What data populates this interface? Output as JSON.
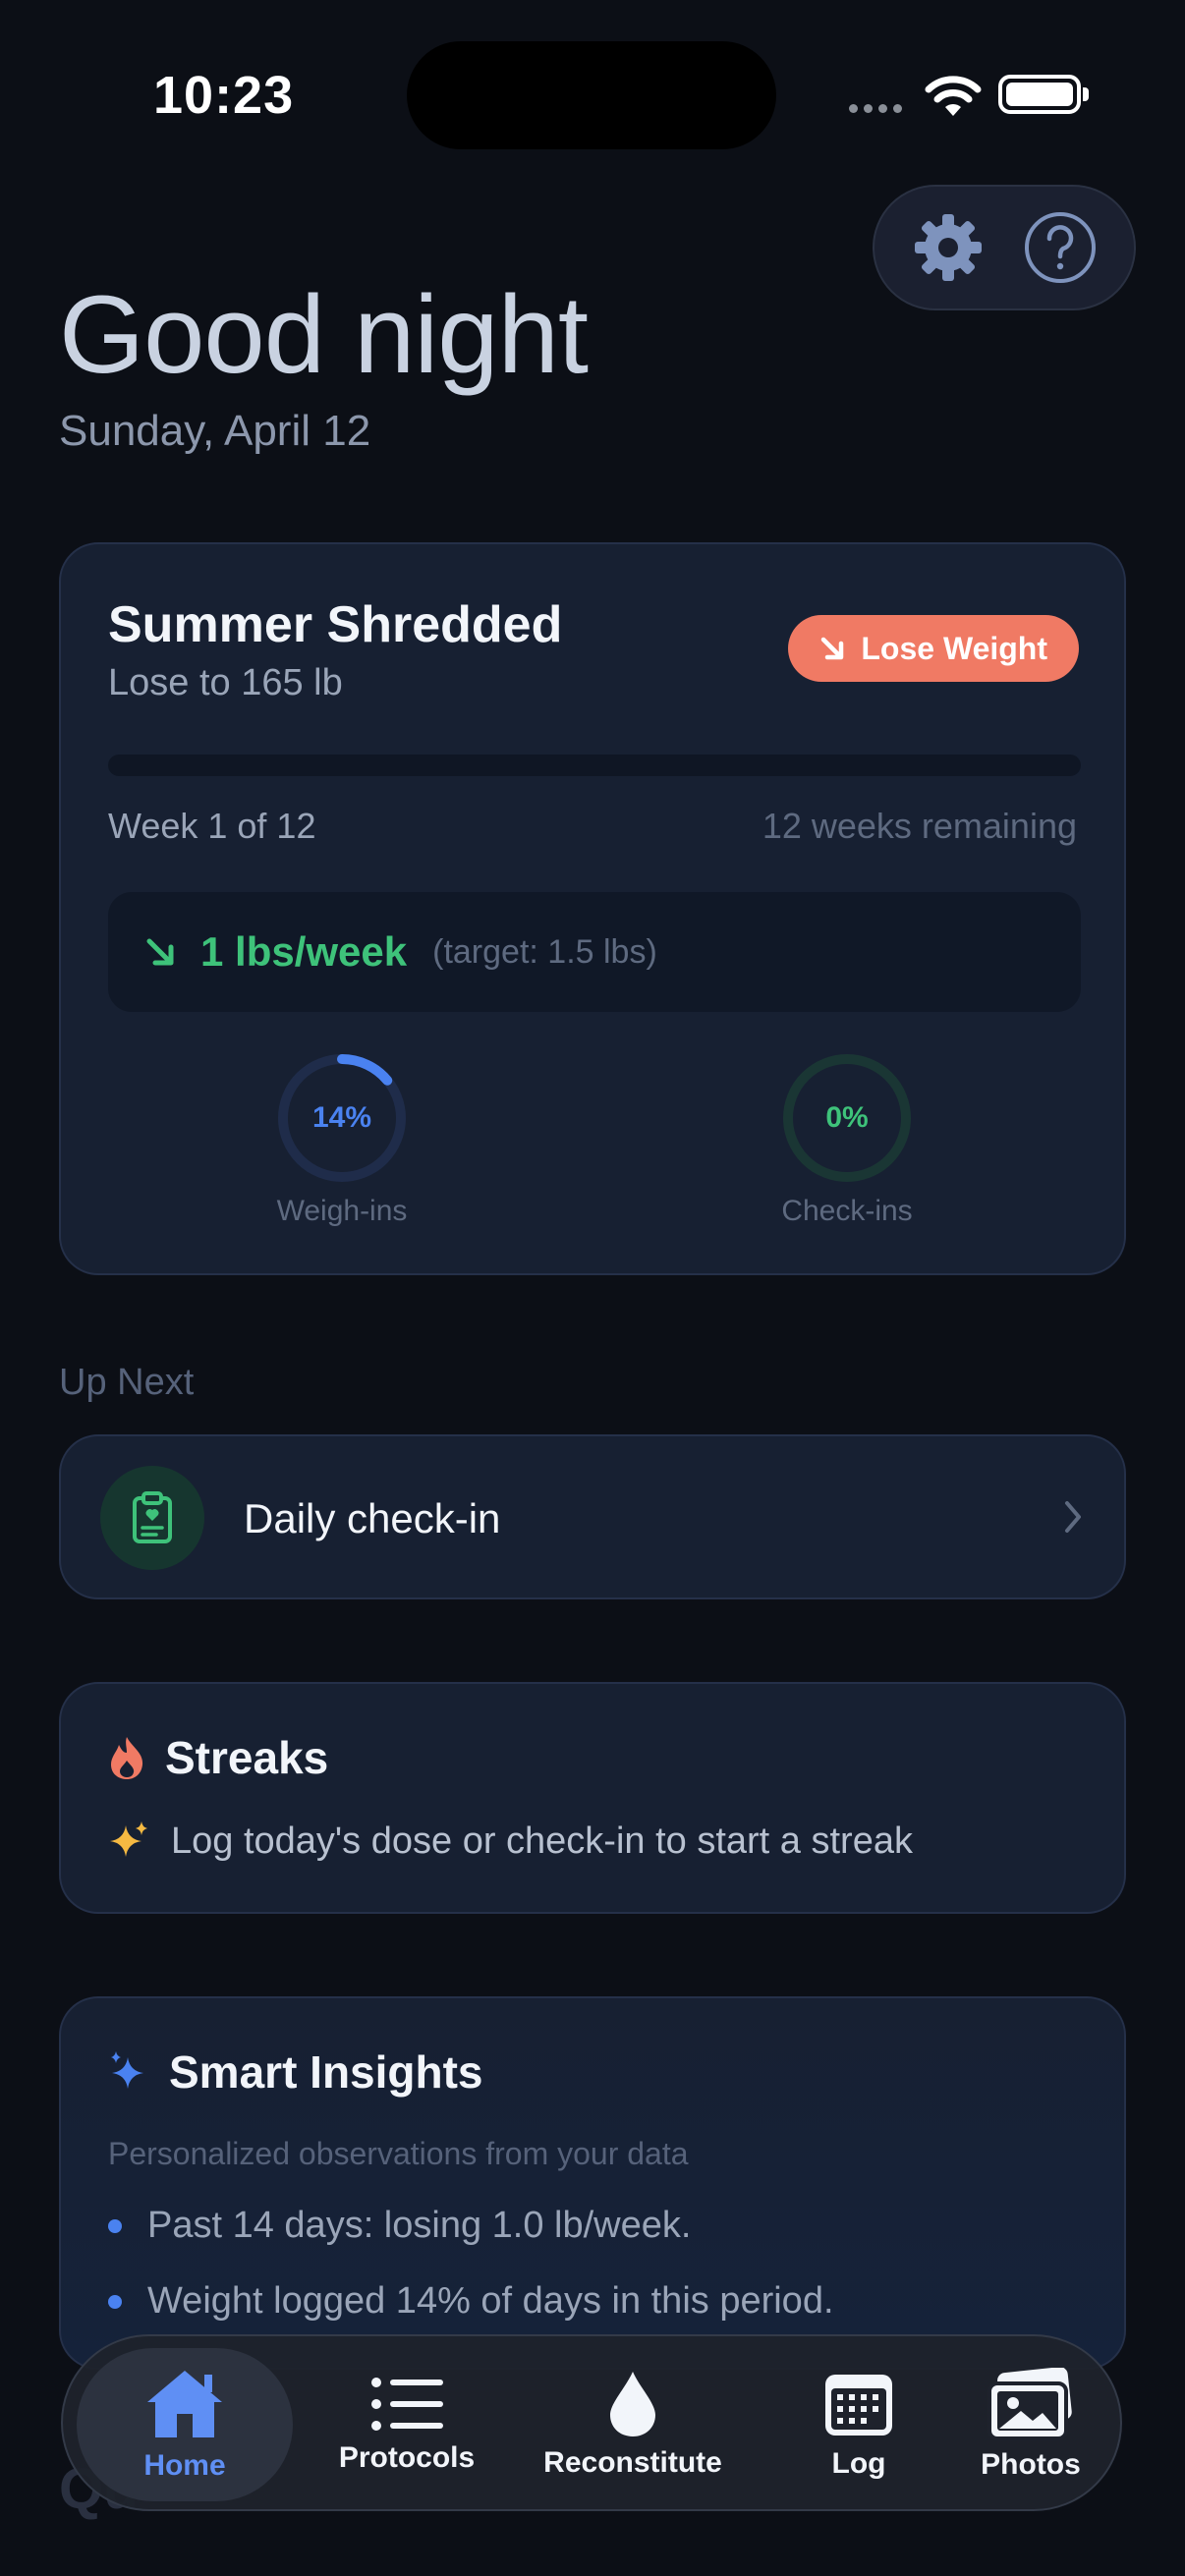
{
  "status_bar": {
    "time": "10:23"
  },
  "header": {
    "greeting": "Good night",
    "date": "Sunday, April 12",
    "settings_icon": "gear-icon",
    "help_icon": "question-circle-icon"
  },
  "goal": {
    "title": "Summer Shredded",
    "subtitle": "Lose to 165 lb",
    "badge_label": "Lose Weight",
    "badge_color": "#f07a64",
    "progress": 0,
    "week_label": "Week 1 of 12",
    "weeks_remaining": "12 weeks remaining",
    "rate_value": "1 lbs/week",
    "rate_target": "(target: 1.5 lbs)",
    "rings": [
      {
        "label": "Weigh-ins",
        "percent_text": "14%",
        "value": 0.14,
        "color": "#4a82f0",
        "track": "#1f2c4a"
      },
      {
        "label": "Check-ins",
        "percent_text": "0%",
        "value": 0,
        "color": "#3ec27a",
        "track": "#1a3634"
      }
    ]
  },
  "up_next": {
    "section_label": "Up Next",
    "item_label": "Daily check-in",
    "icon": "clipboard-heart-icon"
  },
  "streaks": {
    "title": "Streaks",
    "message": "Log today's dose or check-in to start a streak"
  },
  "insights": {
    "title": "Smart Insights",
    "subtitle": "Personalized observations from your data",
    "items": [
      "Past 14 days: losing 1.0 lb/week.",
      "Weight logged 14% of days in this period."
    ]
  },
  "faded_heading": "Qu",
  "tabs": [
    {
      "label": "Home",
      "icon": "house-icon",
      "active": true
    },
    {
      "label": "Protocols",
      "icon": "list-icon",
      "active": false
    },
    {
      "label": "Reconstitute",
      "icon": "droplet-icon",
      "active": false
    },
    {
      "label": "Log",
      "icon": "calendar-icon",
      "active": false
    },
    {
      "label": "Photos",
      "icon": "photos-icon",
      "active": false
    }
  ],
  "colors": {
    "background": "#0c0f16",
    "card": "#172032",
    "accent_blue": "#4a82f0",
    "accent_green": "#3ec27a"
  }
}
